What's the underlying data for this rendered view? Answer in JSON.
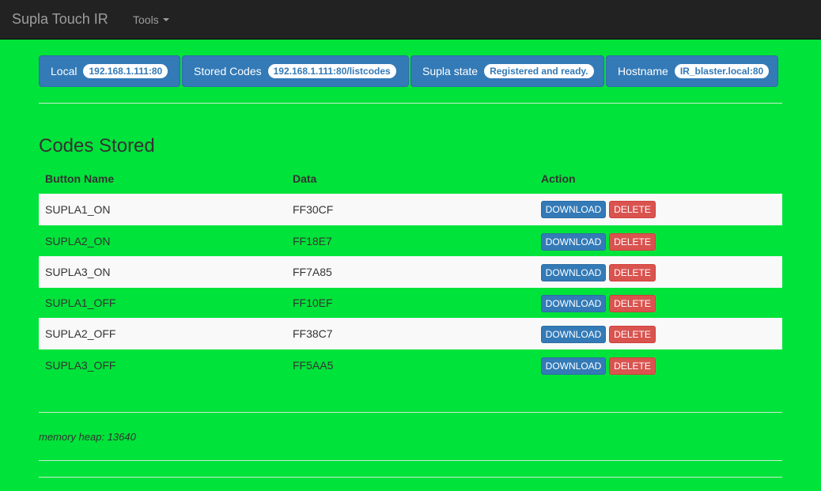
{
  "navbar": {
    "brand": "Supla Touch IR",
    "tools_label": "Tools"
  },
  "info": [
    {
      "label": "Local",
      "badge": "192.168.1.111:80"
    },
    {
      "label": "Stored Codes",
      "badge": "192.168.1.111:80/listcodes"
    },
    {
      "label": "Supla state",
      "badge": "Registered and ready."
    },
    {
      "label": "Hostname",
      "badge": "IR_blaster.local:80"
    }
  ],
  "codes": {
    "title": "Codes Stored",
    "headers": {
      "name": "Button Name",
      "data": "Data",
      "action": "Action"
    },
    "download_label": "DOWNLOAD",
    "delete_label": "DELETE",
    "rows": [
      {
        "name": "SUPLA1_ON",
        "data": "FF30CF"
      },
      {
        "name": "SUPLA2_ON",
        "data": "FF18E7"
      },
      {
        "name": "SUPLA3_ON",
        "data": "FF7A85"
      },
      {
        "name": "SUPLA1_OFF",
        "data": "FF10EF"
      },
      {
        "name": "SUPLA2_OFF",
        "data": "FF38C7"
      },
      {
        "name": "SUPLA3_OFF",
        "data": "FF5AA5"
      }
    ]
  },
  "footer": {
    "memory": "memory heap: 13640"
  },
  "colors": {
    "background": "#00e33a",
    "navbar": "#222222",
    "primary": "#337ab7",
    "danger": "#d9534f"
  }
}
